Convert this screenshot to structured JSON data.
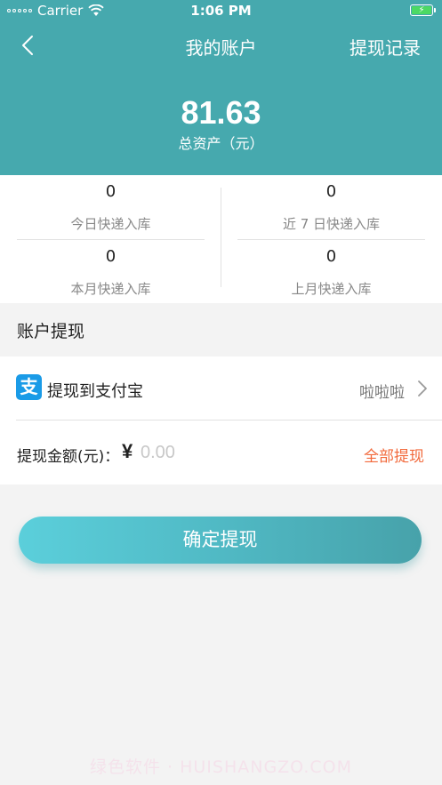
{
  "status_bar": {
    "carrier": "Carrier",
    "time": "1:06 PM"
  },
  "nav": {
    "title": "我的账户",
    "right_label": "提现记录",
    "back_icon": "chevron-left-icon"
  },
  "balance": {
    "value": "81.63",
    "label": "总资产（元）"
  },
  "stats": [
    {
      "value": "0",
      "label": "今日快递入库"
    },
    {
      "value": "0",
      "label": "近 7 日快递入库"
    },
    {
      "value": "0",
      "label": "本月快递入库"
    },
    {
      "value": "0",
      "label": "上月快递入库"
    }
  ],
  "withdraw": {
    "section_title": "账户提现",
    "method_icon": "alipay-icon",
    "method_label": "提现到支付宝",
    "account_name": "啦啦啦",
    "amount_label": "提现金额(元)：",
    "currency_symbol": "¥",
    "amount_placeholder": "0.00",
    "amount_value": "",
    "all_label": "全部提现"
  },
  "confirm_button": "确定提现",
  "watermark": "绿色软件 · HUISHANGZO.COM",
  "colors": {
    "header": "#46a9ae",
    "accent_orange": "#f26a3c",
    "alipay_blue": "#1a9be7",
    "battery_green": "#4cd964"
  }
}
